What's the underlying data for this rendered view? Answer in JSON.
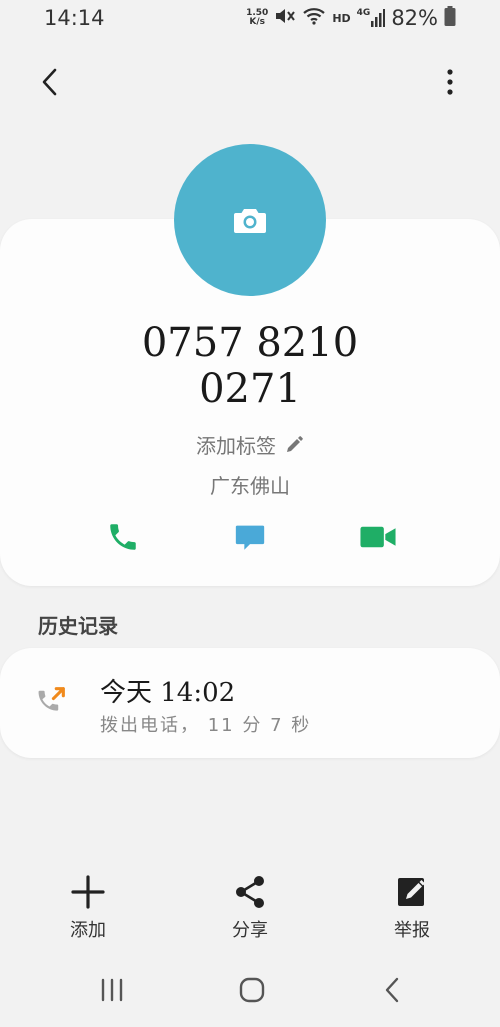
{
  "status_bar": {
    "time": "14:14",
    "net_speed_value": "1.50",
    "net_speed_unit": "K/s",
    "hd_label": "HD",
    "network_label": "4G",
    "battery": "82%"
  },
  "contact": {
    "phone_line1": "0757 8210",
    "phone_line2": "0271",
    "add_tag_label": "添加标签",
    "location": "广东佛山",
    "avatar_color": "#4fb3cd"
  },
  "actions": {
    "call_color": "#1fae66",
    "message_color": "#4aa9d8",
    "video_color": "#1fae66"
  },
  "history": {
    "title": "历史记录",
    "entry_time": "今天 14:02",
    "entry_detail": "拨出电话，  11 分 7 秒",
    "outgoing_color": "#f08a1c"
  },
  "bottom_bar": {
    "add_label": "添加",
    "share_label": "分享",
    "report_label": "举报"
  }
}
